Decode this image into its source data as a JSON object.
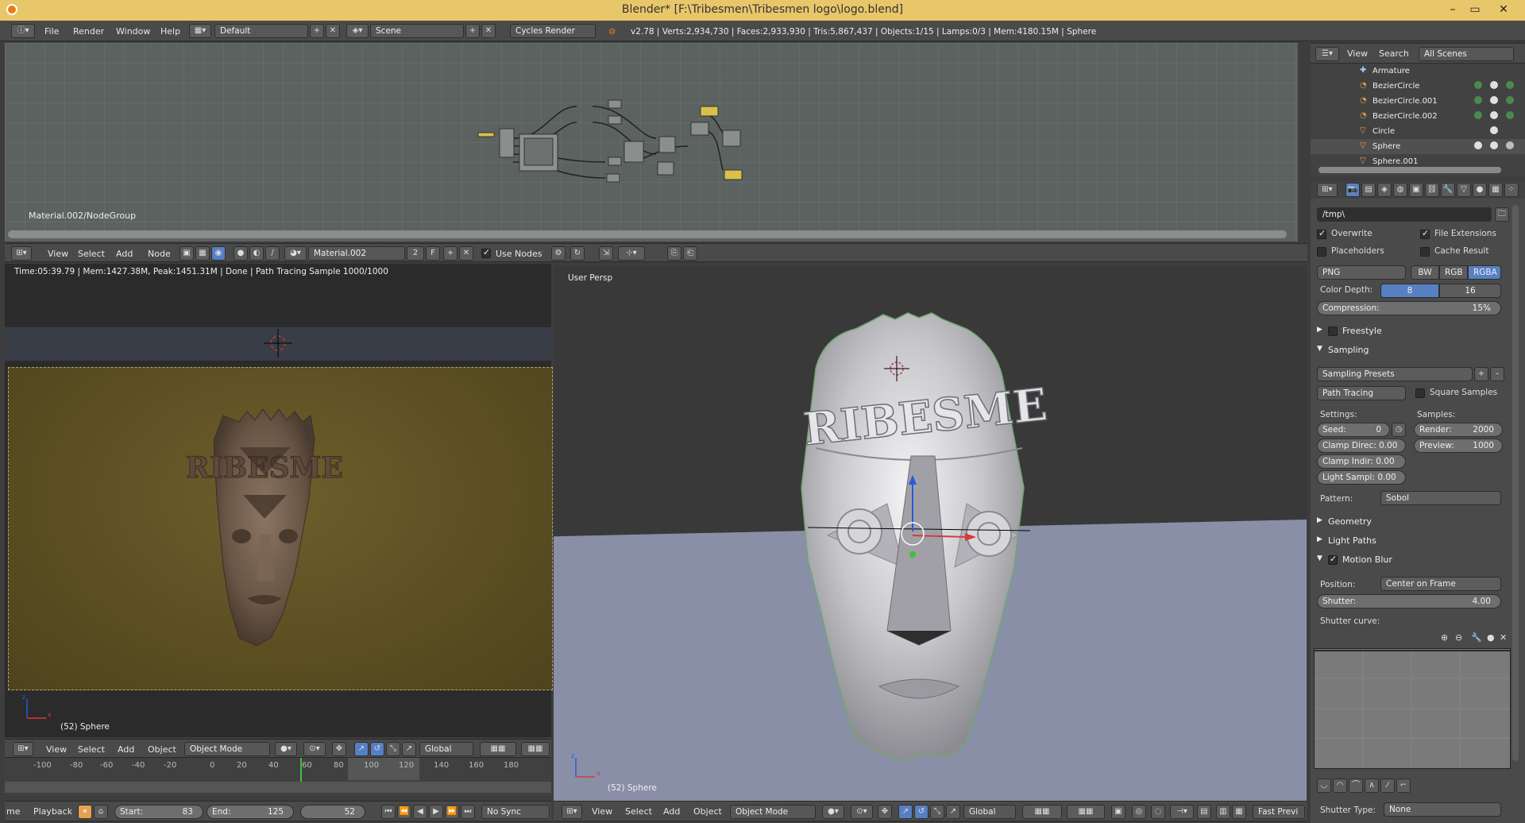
{
  "window": {
    "title": "Blender* [F:\\Tribesmen\\Tribesmen logo\\logo.blend]"
  },
  "info_header": {
    "menus": [
      "File",
      "Render",
      "Window",
      "Help"
    ],
    "layout": "Default",
    "scene": "Scene",
    "engine": "Cycles Render",
    "stats": "v2.78 | Verts:2,934,730 | Faces:2,933,930 | Tris:5,867,437 | Objects:1/15 | Lamps:0/3 | Mem:4180.15M | Sphere"
  },
  "node_editor": {
    "path_label": "Material.002/NodeGroup",
    "header": {
      "menus": [
        "View",
        "Select",
        "Add",
        "Node"
      ],
      "material": "Material.002",
      "users": "2",
      "fake_user": "F",
      "use_nodes_label": "Use Nodes"
    }
  },
  "image_editor": {
    "status": "Time:05:39.79 | Mem:1427.38M, Peak:1451.31M | Done | Path Tracing Sample 1000/1000",
    "object": "(52) Sphere",
    "header": {
      "menus": [
        "View",
        "Select",
        "Add",
        "Object"
      ],
      "mode": "Object Mode",
      "orientation": "Global"
    }
  },
  "viewport": {
    "label": "User Persp",
    "object": "(52) Sphere",
    "header": {
      "menus": [
        "View",
        "Select",
        "Add",
        "Object"
      ],
      "mode": "Object Mode",
      "orientation": "Global",
      "fast_preview": "Fast Previ"
    }
  },
  "timeline": {
    "ticks": [
      "-100",
      "-80",
      "-60",
      "-40",
      "-20",
      "0",
      "20",
      "40",
      "60",
      "80",
      "100",
      "120",
      "140",
      "160",
      "180"
    ],
    "menu_left": "me",
    "playback": "Playback",
    "start_label": "Start:",
    "start_value": "83",
    "end_label": "End:",
    "end_value": "125",
    "current_frame": "52",
    "sync": "No Sync"
  },
  "outliner": {
    "menus": [
      "View",
      "Search"
    ],
    "filter": "All Scenes",
    "items": [
      {
        "name": "Armature",
        "color": "#9fd0ff"
      },
      {
        "name": "BezierCircle",
        "color": "#e8a04a"
      },
      {
        "name": "BezierCircle.001",
        "color": "#e8a04a"
      },
      {
        "name": "BezierCircle.002",
        "color": "#e8a04a"
      },
      {
        "name": "Circle",
        "color": "#e8a04a"
      },
      {
        "name": "Sphere",
        "color": "#e8a04a"
      },
      {
        "name": "Sphere.001",
        "color": "#e8a04a"
      }
    ]
  },
  "properties": {
    "output_path": "/tmp\\",
    "overwrite": "Overwrite",
    "file_extensions": "File Extensions",
    "placeholders": "Placeholders",
    "cache_result": "Cache Result",
    "format": "PNG",
    "color_modes": [
      "BW",
      "RGB",
      "RGBA"
    ],
    "color_depth_label": "Color Depth:",
    "color_depth": [
      "8",
      "16"
    ],
    "compression_label": "Compression:",
    "compression": "15%",
    "freestyle": "Freestyle",
    "sampling": "Sampling",
    "sampling_presets": "Sampling Presets",
    "integrator": "Path Tracing",
    "square_samples": "Square Samples",
    "settings_label": "Settings:",
    "samples_label": "Samples:",
    "seed_label": "Seed:",
    "seed": "0",
    "clamp_direct": "Clamp Direc: 0.00",
    "clamp_indirect": "Clamp Indir: 0.00",
    "light_sampling": "Light Sampl: 0.00",
    "render_label": "Render:",
    "render_samples": "2000",
    "preview_label": "Preview:",
    "preview_samples": "1000",
    "pattern_label": "Pattern:",
    "pattern": "Sobol",
    "geometry": "Geometry",
    "light_paths": "Light Paths",
    "motion_blur": "Motion Blur",
    "position_label": "Position:",
    "position": "Center on Frame",
    "shutter_label": "Shutter:",
    "shutter": "4.00",
    "shutter_curve": "Shutter curve:",
    "shutter_type_label": "Shutter Type:",
    "shutter_type": "None"
  }
}
